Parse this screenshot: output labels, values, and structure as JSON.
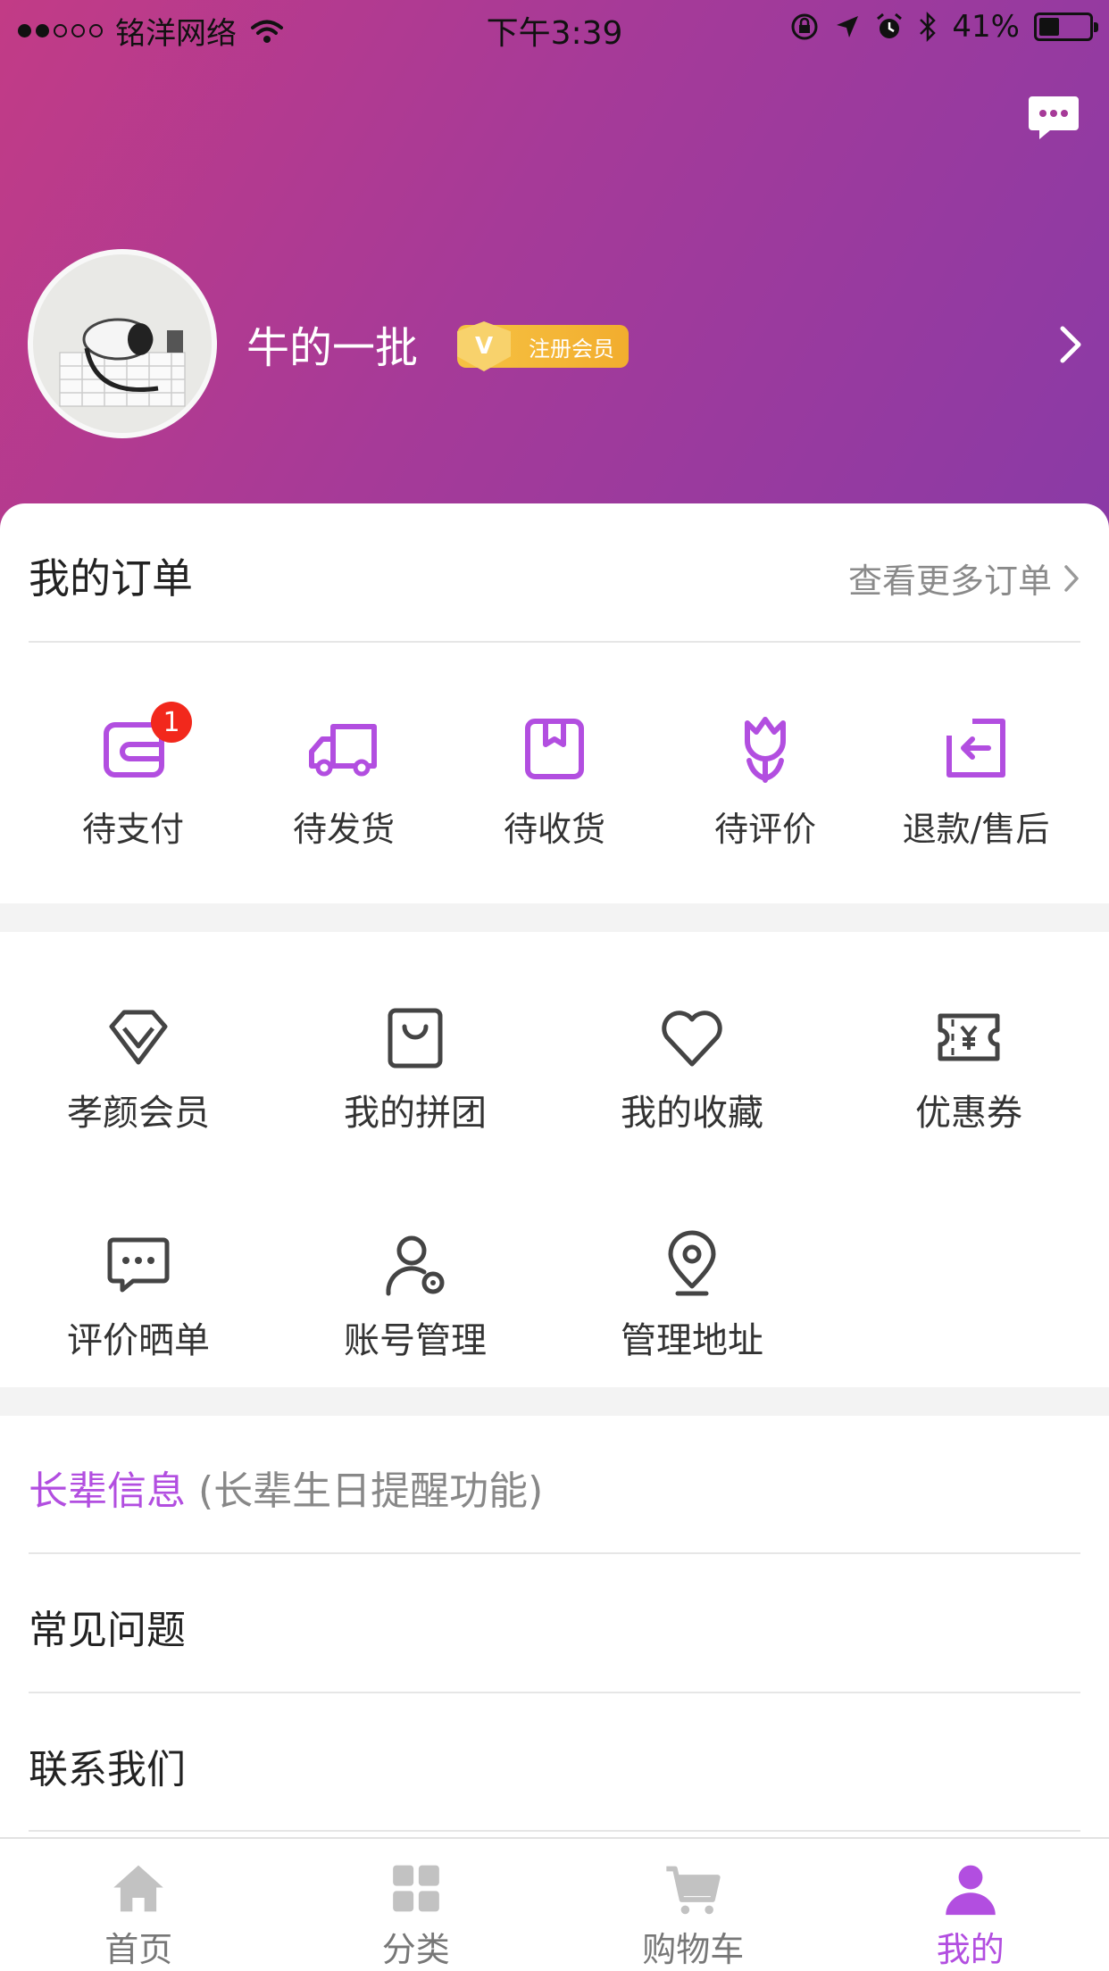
{
  "status_bar": {
    "carrier": "铭洋网络",
    "time": "下午3:39",
    "battery": "41%",
    "battery_level": 0.41
  },
  "profile": {
    "name": "牛的一批",
    "member_label": "注册会员",
    "member_icon_letter": "V"
  },
  "orders": {
    "title": "我的订单",
    "more_label": "查看更多订单",
    "items": [
      {
        "label": "待支付",
        "badge": "1"
      },
      {
        "label": "待发货"
      },
      {
        "label": "待收货"
      },
      {
        "label": "待评价"
      },
      {
        "label": "退款/售后"
      }
    ]
  },
  "services": [
    {
      "label": "孝颜会员",
      "icon": "diamond-icon"
    },
    {
      "label": "我的拼团",
      "icon": "bag-icon"
    },
    {
      "label": "我的收藏",
      "icon": "heart-icon"
    },
    {
      "label": "优惠券",
      "icon": "coupon-icon"
    },
    {
      "label": "评价晒单",
      "icon": "comment-icon"
    },
    {
      "label": "账号管理",
      "icon": "user-settings-icon"
    },
    {
      "label": "管理地址",
      "icon": "location-icon"
    }
  ],
  "list": {
    "elder_title": "长辈信息",
    "elder_subtitle": "(长辈生日提醒功能)",
    "faq": "常见问题",
    "contact": "联系我们"
  },
  "tabs": [
    {
      "label": "首页",
      "icon": "home-icon"
    },
    {
      "label": "分类",
      "icon": "grid-icon"
    },
    {
      "label": "购物车",
      "icon": "cart-icon"
    },
    {
      "label": "我的",
      "icon": "person-icon",
      "active": true
    }
  ],
  "colors": {
    "accent": "#b24ee0",
    "header_gradient_start": "#c23b86",
    "header_gradient_end": "#8a3aa6",
    "badge_red": "#f2281c",
    "member_gold": "#f2ad2e"
  }
}
